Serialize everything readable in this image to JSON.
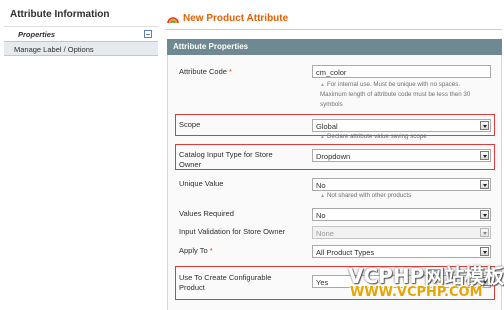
{
  "sidebar": {
    "title": "Attribute Information",
    "tabs": [
      {
        "label": "Properties"
      },
      {
        "label": "Manage Label / Options"
      }
    ]
  },
  "page": {
    "title": "New Product Attribute",
    "section": "Attribute Properties"
  },
  "fields": {
    "attribute_code": {
      "label": "Attribute Code",
      "required": "*",
      "value": "cm_color",
      "note1": "For internal use. Must be unique with no spaces.",
      "note2": "Maximum length of attribute code must be less then 30",
      "note3": "symbols"
    },
    "scope": {
      "label": "Scope",
      "value": "Global",
      "note": "Declare attribute value saving scope"
    },
    "catalog_input": {
      "label1": "Catalog Input Type for Store",
      "label2": "Owner",
      "value": "Dropdown"
    },
    "unique_value": {
      "label": "Unique Value",
      "value": "No",
      "note": "Not shared with other products"
    },
    "values_required": {
      "label": "Values Required",
      "value": "No"
    },
    "input_validation": {
      "label": "Input Validation for Store Owner",
      "value": "None"
    },
    "apply_to": {
      "label": "Apply To",
      "required": "*",
      "value": "All Product Types"
    },
    "configurable": {
      "label1": "Use To Create Configurable",
      "label2": "Product",
      "value": "Yes"
    }
  },
  "watermark": {
    "line1": "VCPHP网站模板",
    "line2": "WWW.VCPHP.COM"
  },
  "colors": {
    "accent": "#eb5e00",
    "section_header": "#6f8992",
    "highlight": "#e23b3b"
  }
}
